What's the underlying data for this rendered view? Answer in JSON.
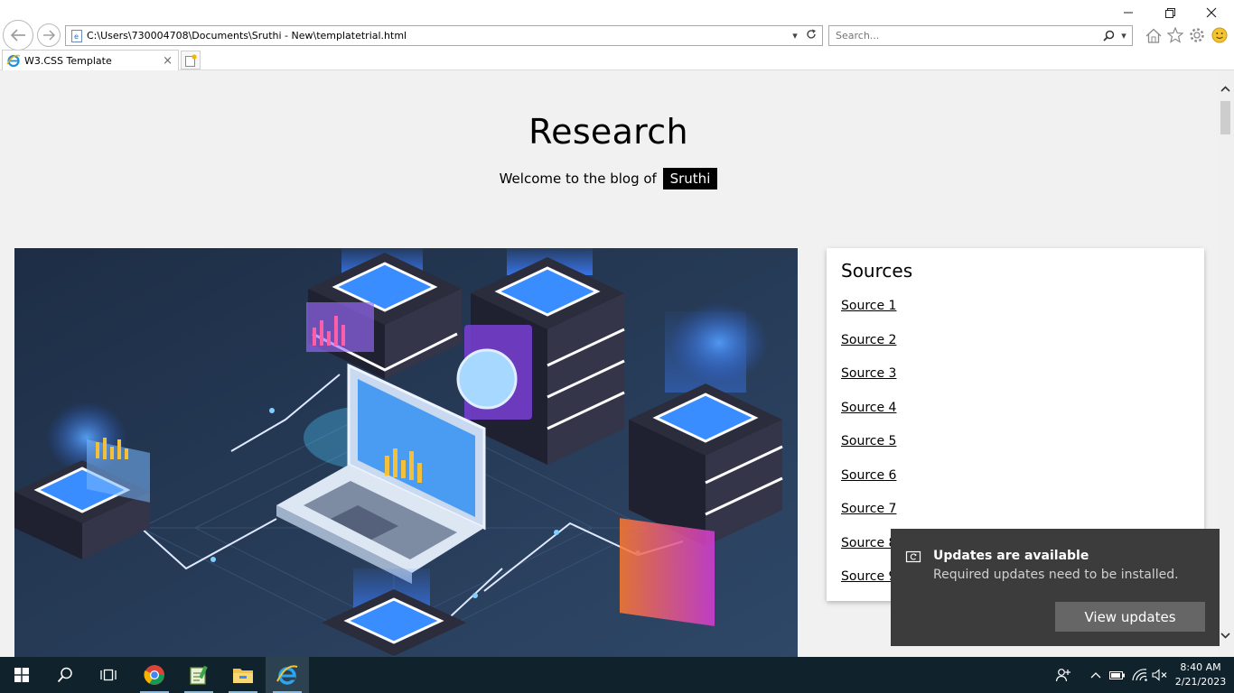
{
  "browser": {
    "address": "C:\\Users\\730004708\\Documents\\Sruthi - New\\templatetrial.html",
    "search_placeholder": "Search...",
    "tab_title": "W3.CSS Template",
    "tab_close": "×"
  },
  "page": {
    "title": "Research",
    "welcome_prefix": "Welcome to the blog of",
    "welcome_name": "Sruthi"
  },
  "sources": {
    "title": "Sources",
    "items": [
      "Source 1",
      "Source 2",
      "Source 3",
      "Source 4",
      "Source 5",
      "Source 6",
      "Source 7",
      "Source 8",
      "Source 9"
    ]
  },
  "toast": {
    "title": "Updates are available",
    "body": "Required updates need to be installed.",
    "button": "View updates"
  },
  "clock": {
    "time": "8:40 AM",
    "date": "2/21/2023"
  },
  "colors": {
    "page_bg": "#f1f1f1",
    "hero_bg": "#243650",
    "taskbar": "#10232d",
    "toast_bg": "#3c3c3c"
  }
}
